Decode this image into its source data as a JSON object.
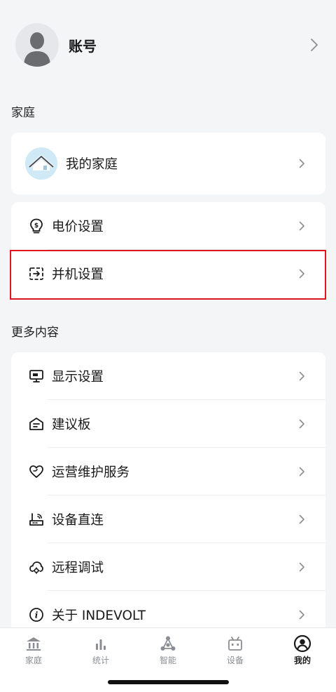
{
  "account": {
    "name": "账号"
  },
  "sections": {
    "home": "家庭",
    "more": "更多内容"
  },
  "home_card": {
    "label": "我的家庭"
  },
  "settings": [
    {
      "label": "电价设置",
      "icon": "price-icon"
    },
    {
      "label": "并机设置",
      "icon": "parallel-icon"
    }
  ],
  "more": [
    {
      "label": "显示设置",
      "icon": "display-icon"
    },
    {
      "label": "建议板",
      "icon": "suggestion-icon"
    },
    {
      "label": "运营维护服务",
      "icon": "service-icon"
    },
    {
      "label": "设备直连",
      "icon": "direct-connect-icon"
    },
    {
      "label": "远程调试",
      "icon": "remote-debug-icon"
    },
    {
      "label": "关于 INDEVOLT",
      "icon": "about-icon"
    }
  ],
  "tabs": [
    {
      "label": "家庭",
      "icon": "home-icon"
    },
    {
      "label": "统计",
      "icon": "stats-icon"
    },
    {
      "label": "智能",
      "icon": "smart-icon"
    },
    {
      "label": "设备",
      "icon": "device-icon"
    },
    {
      "label": "我的",
      "icon": "profile-icon",
      "active": true
    }
  ],
  "colors": {
    "highlight": "#e0161e",
    "background": "#f4f5f7",
    "card": "#ffffff"
  }
}
